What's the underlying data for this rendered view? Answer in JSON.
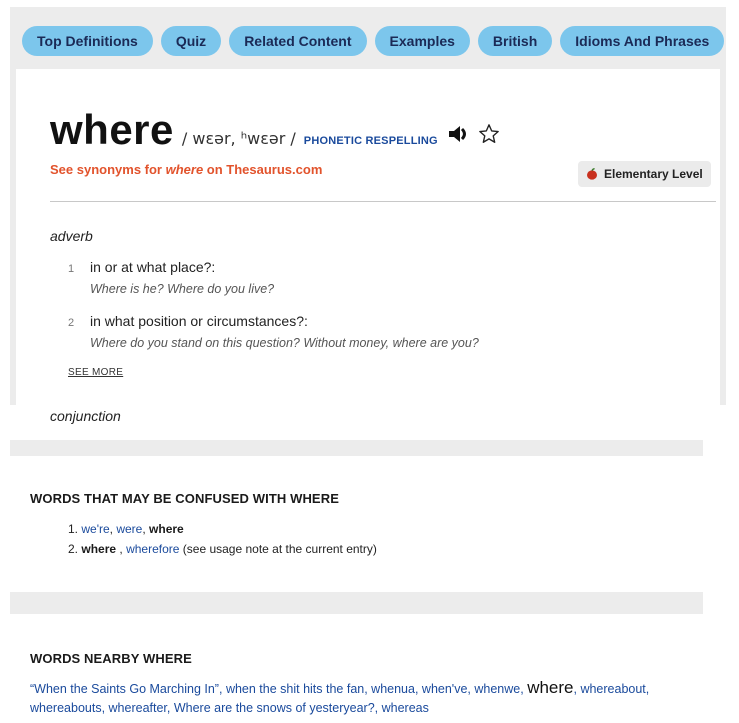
{
  "tabs": [
    "Top Definitions",
    "Quiz",
    "Related Content",
    "Examples",
    "British",
    "Idioms And Phrases"
  ],
  "entry": {
    "headword": "where",
    "pronunciation": "/ wɛər, ʰwɛər /",
    "phonetic_label": "PHONETIC RESPELLING",
    "synonyms_prefix": "See synonyms for ",
    "synonyms_word": "where",
    "synonyms_suffix": " on Thesaurus.com",
    "level_label": "Elementary Level"
  },
  "adverb": {
    "pos": "adverb",
    "senses": [
      {
        "num": "1",
        "text": "in or at what place?:",
        "example": "Where is he? Where do you live?"
      },
      {
        "num": "2",
        "text": "in what position or circumstances?:",
        "example": "Where do you stand on this question? Without money, where are you?"
      }
    ],
    "see_more": "SEE MORE"
  },
  "conjunction": {
    "pos": "conjunction"
  },
  "confused": {
    "heading": "WORDS THAT MAY BE CONFUSED WITH WHERE",
    "line1": {
      "num": "1.",
      "a": "we're",
      "sep1": ", ",
      "b": "were",
      "sep2": ", ",
      "c": "where"
    },
    "line2": {
      "num": "2.",
      "a": "where",
      "sep1": " , ",
      "b": "wherefore",
      "note": " (see usage note at the current entry)"
    }
  },
  "nearby": {
    "heading": "WORDS NEARBY WHERE",
    "before": [
      "“When the Saints Go Marching In”",
      "when the shit hits the fan",
      "whenua",
      "when've",
      "whenwe"
    ],
    "current": "where",
    "after": [
      "whereabout",
      "whereabouts",
      "whereafter",
      "Where are the snows of yesteryear?",
      "whereas"
    ]
  },
  "colors": {
    "pill": "#7cc6ec",
    "link": "#1a4a9c",
    "synonym": "#e2532c",
    "band": "#ececec"
  }
}
